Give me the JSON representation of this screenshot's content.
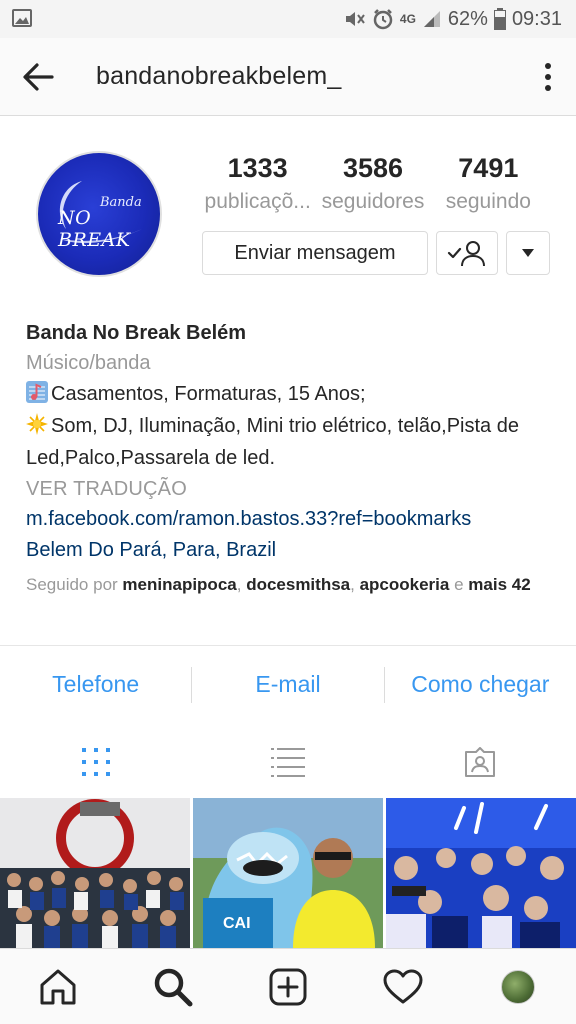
{
  "status_bar": {
    "network": "4G",
    "battery": "62%",
    "time": "09:31"
  },
  "top_bar": {
    "username": "bandanobreakbelem_"
  },
  "profile": {
    "avatar_text_small": "Banda",
    "avatar_text_big": "NO BREAK",
    "stats": [
      {
        "value": "1333",
        "label": "publicaçõ..."
      },
      {
        "value": "3586",
        "label": "seguidores"
      },
      {
        "value": "7491",
        "label": "seguindo"
      }
    ],
    "message_button": "Enviar mensagem"
  },
  "bio": {
    "name": "Banda No Break Belém",
    "category": "Músico/banda",
    "line1": "Casamentos, Formaturas, 15 Anos;",
    "line2": "Som, DJ, Iluminação, Mini trio elétrico, telão,Pista de Led,Palco,Passarela de led.",
    "translate": "VER TRADUÇÃO",
    "link": "m.facebook.com/ramon.bastos.33?ref=bookmarks",
    "location": "Belem Do Pará, Para, Brazil",
    "followed_by_prefix": "Seguido por",
    "followed_by_users": [
      "meninapipoca",
      "docesmithsa",
      "apcookeria"
    ],
    "followed_by_conj": "e",
    "followed_by_more": "mais 42"
  },
  "actions": [
    {
      "label": "Telefone"
    },
    {
      "label": "E-mail"
    },
    {
      "label": "Como chegar"
    }
  ],
  "colors": {
    "link_blue": "#3897f0",
    "bio_link": "#003569",
    "muted": "#999999"
  }
}
